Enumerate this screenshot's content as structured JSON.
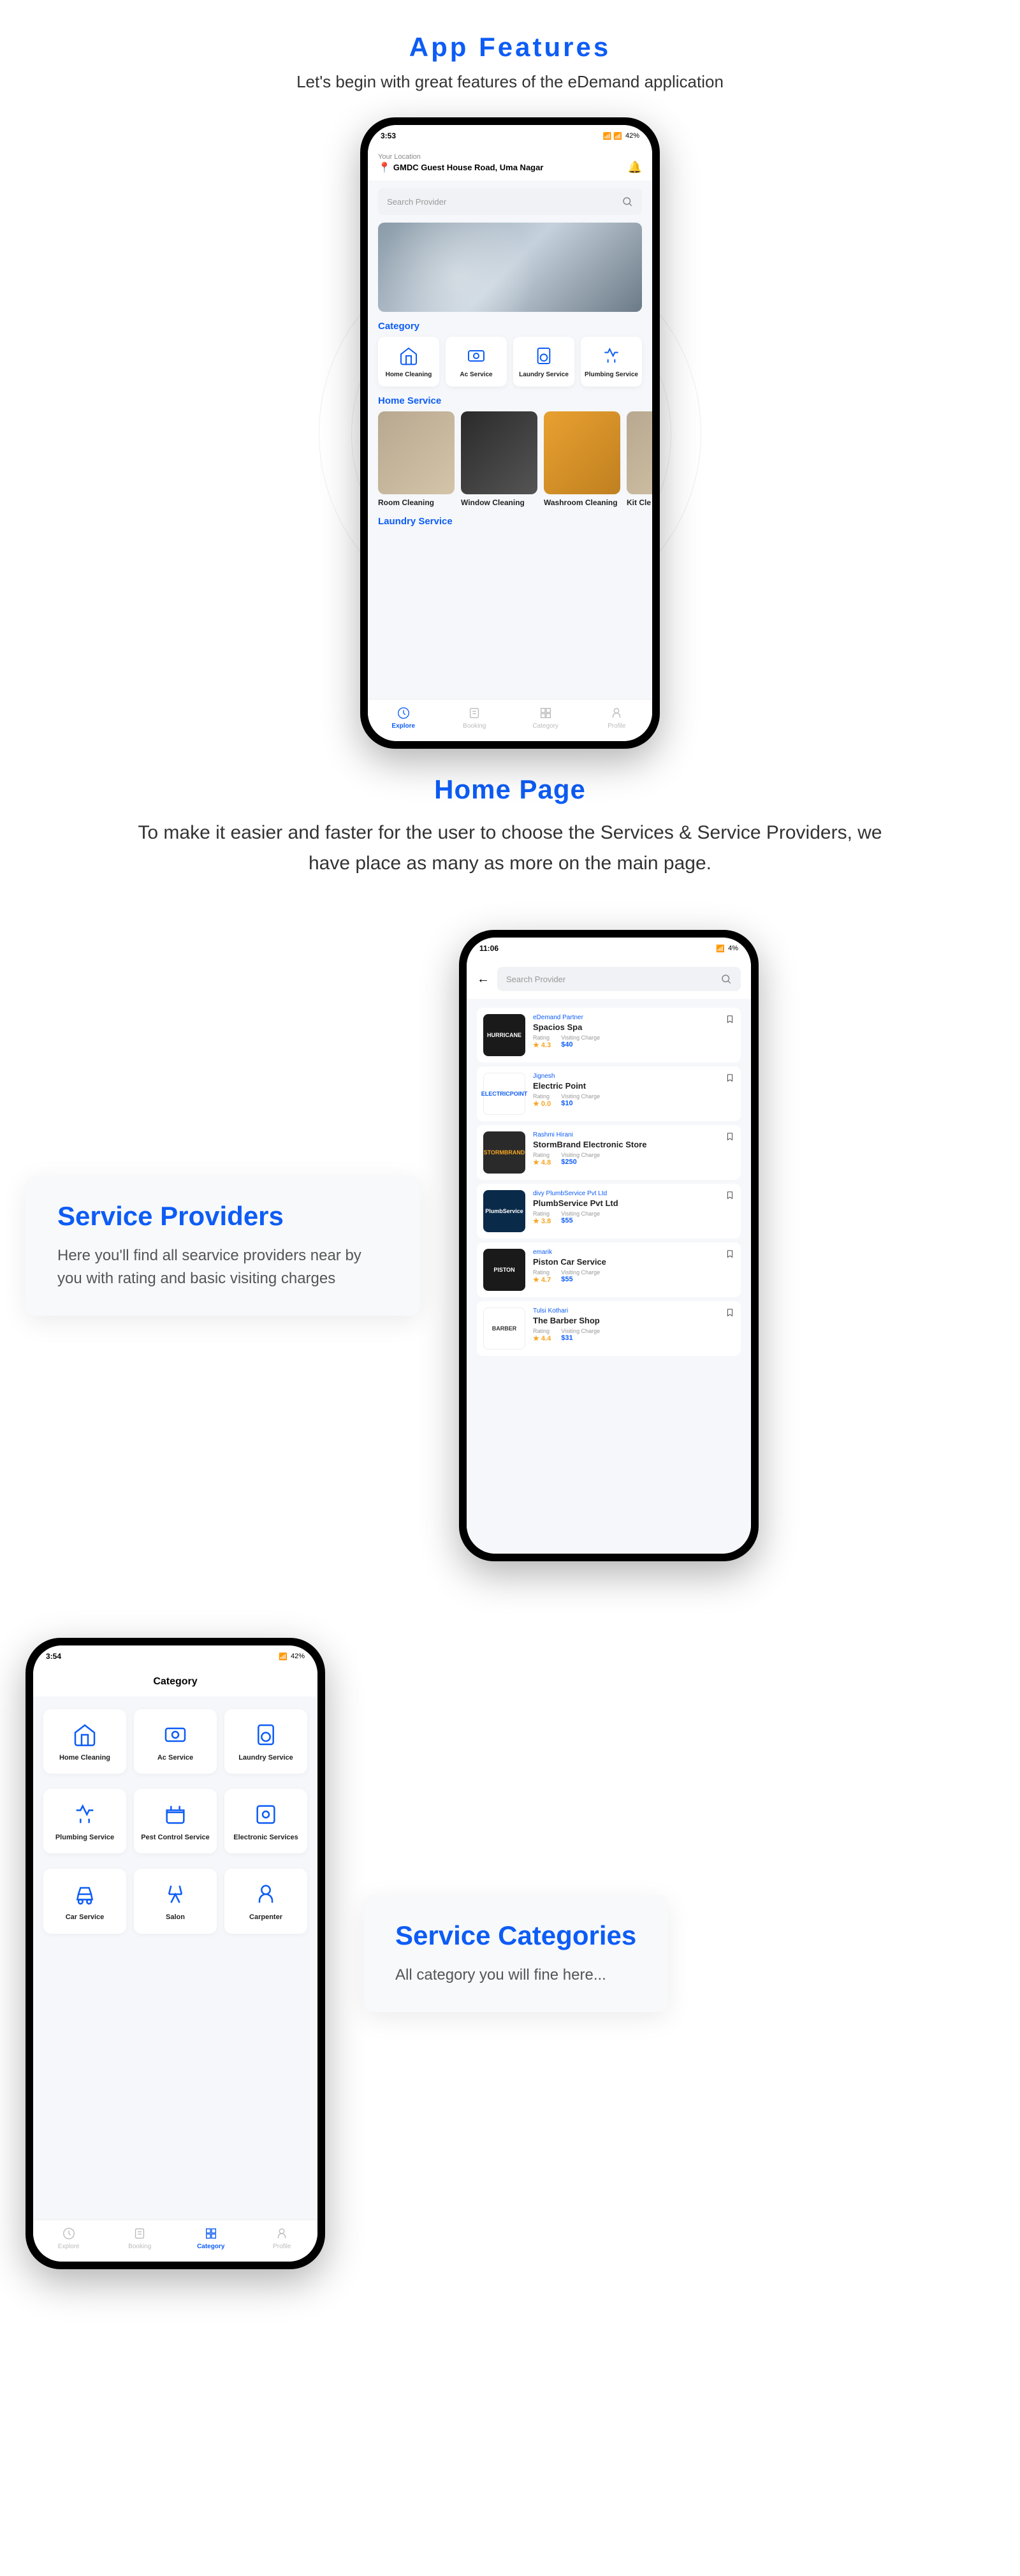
{
  "features": {
    "title": "App Features",
    "subtitle": "Let's begin with great features of the eDemand application"
  },
  "home": {
    "title": "Home Page",
    "desc": "To make it easier and faster for the user to choose the Services & Service Providers, we have place as many as more on the main page.",
    "status_time": "3:53",
    "status_battery": "42%",
    "loc_label": "Your Location",
    "loc_text": "GMDC Guest House Road, Uma Nagar",
    "search_placeholder": "Search Provider",
    "sec_category": "Category",
    "sec_home_service": "Home Service",
    "sec_laundry": "Laundry Service",
    "categories": [
      {
        "label": "Home Cleaning"
      },
      {
        "label": "Ac Service"
      },
      {
        "label": "Laundry Service"
      },
      {
        "label": "Plumbing Service"
      }
    ],
    "services": [
      {
        "label": "Room Cleaning"
      },
      {
        "label": "Window Cleaning"
      },
      {
        "label": "Washroom Cleaning"
      },
      {
        "label": "Kit Cle"
      }
    ],
    "nav": [
      {
        "label": "Explore"
      },
      {
        "label": "Booking"
      },
      {
        "label": "Category"
      },
      {
        "label": "Profile"
      }
    ]
  },
  "providers_side": {
    "title": "Service Providers",
    "desc": "Here you'll find all searvice providers near by you with rating and basic visiting charges"
  },
  "providers": {
    "status_time": "11:06",
    "status_battery": "4%",
    "search_placeholder": "Search Provider",
    "rating_label": "Rating",
    "charge_label": "Visiting Charge",
    "list": [
      {
        "partner": "eDemand Partner",
        "name": "Spacios Spa",
        "rating": "★ 4.3",
        "charge": "$40",
        "logo_class": "logo-hurricane",
        "logo_text": "HURRICANE"
      },
      {
        "partner": "Jignesh",
        "name": "Electric Point",
        "rating": "★ 0.0",
        "charge": "$10",
        "logo_class": "logo-electric",
        "logo_text": "ELECTRICPOINT"
      },
      {
        "partner": "Rashmi Hirani",
        "name": "StormBrand Electronic Store",
        "rating": "★ 4.8",
        "charge": "$250",
        "logo_class": "logo-storm",
        "logo_text": "STORMBRAND"
      },
      {
        "partner": "divy PlumbService Pvt Ltd",
        "name": "PlumbService Pvt Ltd",
        "rating": "★ 3.8",
        "charge": "$55",
        "logo_class": "logo-plumb",
        "logo_text": "PlumbService"
      },
      {
        "partner": "emarik",
        "name": "Piston Car Service",
        "rating": "★ 4.7",
        "charge": "$55",
        "logo_class": "logo-piston",
        "logo_text": "PISTON"
      },
      {
        "partner": "Tulsi Kothari",
        "name": "The Barber Shop",
        "rating": "★ 4.4",
        "charge": "$31",
        "logo_class": "logo-barber",
        "logo_text": "BARBER"
      }
    ]
  },
  "categories_side": {
    "title": "Service Categories",
    "desc": "All category you will fine here..."
  },
  "categories_page": {
    "status_time": "3:54",
    "status_battery": "42%",
    "title": "Category",
    "items": [
      {
        "label": "Home Cleaning"
      },
      {
        "label": "Ac Service"
      },
      {
        "label": "Laundry Service"
      },
      {
        "label": "Plumbing Service"
      },
      {
        "label": "Pest Control Service"
      },
      {
        "label": "Electronic Services"
      },
      {
        "label": "Car Service"
      },
      {
        "label": "Salon"
      },
      {
        "label": "Carpenter"
      }
    ],
    "nav": [
      {
        "label": "Explore"
      },
      {
        "label": "Booking"
      },
      {
        "label": "Category"
      },
      {
        "label": "Profile"
      }
    ]
  }
}
